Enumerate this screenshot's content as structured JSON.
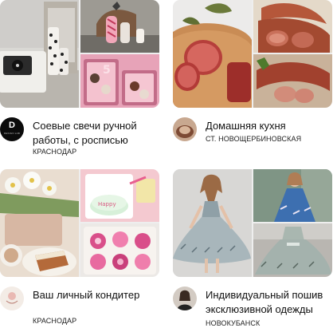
{
  "cards": [
    {
      "title": "Соевые свечи ручной работы, с росписью",
      "city": "КРАСНОДАР",
      "avatar": {
        "icon": "brand-logo-icon",
        "letter": "D",
        "caption": "DESIGN LAB"
      }
    },
    {
      "title": "Домашняя кухня",
      "city": "СТ. НОВОЩЕРБИНОВСКАЯ",
      "avatar": {
        "icon": "cook-photo-avatar"
      }
    },
    {
      "title": "Ваш личный кондитер",
      "city": "КРАСНОДАР",
      "avatar": {
        "icon": "confectioner-logo-avatar"
      }
    },
    {
      "title": "Индивидуальный пошив эксклюзивной одежды",
      "city": "НОВОКУБАНСК",
      "avatar": {
        "icon": "seamstress-photo-avatar"
      }
    }
  ]
}
